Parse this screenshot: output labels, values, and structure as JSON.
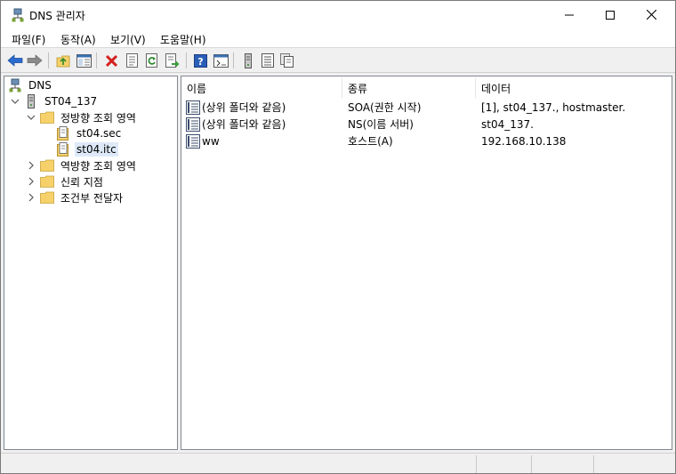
{
  "window": {
    "title": "DNS 관리자"
  },
  "menu": [
    "파일(F)",
    "동작(A)",
    "보기(V)",
    "도움말(H)"
  ],
  "toolbar_icons": [
    "back-arrow-icon",
    "forward-arrow-icon",
    "up-folder-icon",
    "show-hide-tree-icon",
    "delete-icon",
    "properties-icon",
    "refresh-icon",
    "export-list-icon",
    "help-icon",
    "show-console-icon",
    "server-icon",
    "records-icon",
    "copy-icon"
  ],
  "tree": {
    "root": "DNS",
    "server": "ST04_137",
    "forward_zones": "정방향 조회 영역",
    "zones": [
      "st04.sec",
      "st04.itc"
    ],
    "reverse_zones": "역방향 조회 영역",
    "trust_points": "신뢰 지점",
    "conditional_forwarders": "조건부 전달자"
  },
  "list": {
    "columns": [
      "이름",
      "종류",
      "데이터"
    ],
    "rows": [
      {
        "name": "(상위 폴더와 같음)",
        "type": "SOA(권한 시작)",
        "data": "[1], st04_137., hostmaster."
      },
      {
        "name": "(상위 폴더와 같음)",
        "type": "NS(이름 서버)",
        "data": "st04_137."
      },
      {
        "name": "ww",
        "type": "호스트(A)",
        "data": "192.168.10.138"
      }
    ]
  },
  "colors": {
    "selection": "#dde9f7",
    "folder": "#f6d16a",
    "accent_blue": "#2a6ccf",
    "delete_red": "#d42020"
  }
}
